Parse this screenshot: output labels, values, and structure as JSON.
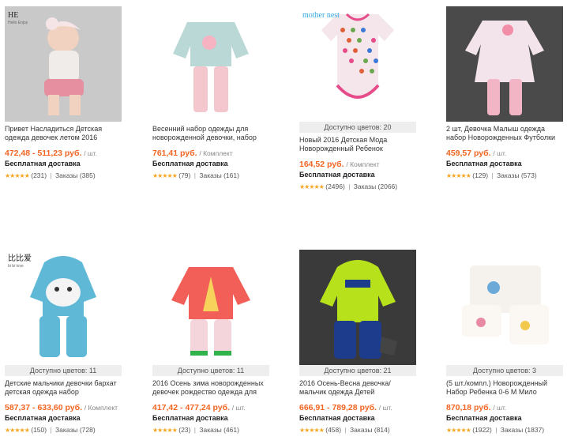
{
  "products": [
    {
      "title": "Привет Насладиться Детская одежда девочек летом 2016",
      "colors": "",
      "price": "472,48 - 511,23 руб.",
      "unit": "/ шт.",
      "shipping": "Бесплатная доставка",
      "reviews": "(231)",
      "orders": "Заказы (385)",
      "brand": "HE",
      "brand_sub": "Hello Enjoy",
      "theme": {
        "bg": "#c9c9c9",
        "main": "#f0ecea",
        "accent": "#e58fa0"
      }
    },
    {
      "title": "Весенний набор одежды для новорожденной девочки, набор",
      "colors": "",
      "price": "761,41 руб.",
      "unit": "/ Комплект",
      "shipping": "Бесплатная доставка",
      "reviews": "(79)",
      "orders": "Заказы (161)",
      "brand": "",
      "brand_sub": "",
      "theme": {
        "bg": "#ffffff",
        "main": "#b9d8d6",
        "accent": "#f4c7cf"
      }
    },
    {
      "title": "Новый 2016 Детская Мода Новорожденный Ребенок",
      "colors": "Доступно цветов: 20",
      "price": "164,52 руб.",
      "unit": "/ Комплект",
      "shipping": "Бесплатная доставка",
      "reviews": "(2496)",
      "orders": "Заказы (2066)",
      "brand": "mother nest",
      "brand_sub": "",
      "theme": {
        "bg": "#ffffff",
        "main": "#f4e6ea",
        "accent": "#e64b8a"
      }
    },
    {
      "title": "2 шт, Девочка Малыш одежда набор Новорожденных Футболки",
      "colors": "",
      "price": "459,57 руб.",
      "unit": "/ шт.",
      "shipping": "Бесплатная доставка",
      "reviews": "(129)",
      "orders": "Заказы (573)",
      "brand": "",
      "brand_sub": "",
      "theme": {
        "bg": "#4a4a4a",
        "main": "#f3e3ea",
        "accent": "#f2b5c6"
      }
    },
    {
      "title": "Детские мальчики девочки бархат детская одежда набор",
      "colors": "Доступно цветов: 11",
      "price": "587,37 - 633,60 руб.",
      "unit": "/ Комплект",
      "shipping": "Бесплатная доставка",
      "reviews": "(150)",
      "orders": "Заказы (728)",
      "brand": "比比爱",
      "brand_sub": "bi bi love",
      "theme": {
        "bg": "#ffffff",
        "main": "#5fb9d6",
        "accent": "#f4f4f4"
      }
    },
    {
      "title": "2016 Осень зима новорожденных девочек рождество одежда для",
      "colors": "Доступно цветов: 11",
      "price": "417,42 - 477,24 руб.",
      "unit": "/ шт.",
      "shipping": "Бесплатная доставка",
      "reviews": "(23)",
      "orders": "Заказы (461)",
      "brand": "",
      "brand_sub": "",
      "theme": {
        "bg": "#ffffff",
        "main": "#f25f58",
        "accent": "#2fb34a"
      }
    },
    {
      "title": "2016 Осень-Весна девочка/мальчик одежда Детей",
      "colors": "Доступно цветов: 21",
      "price": "666,91 - 789,28 руб.",
      "unit": "/ шт.",
      "shipping": "Бесплатная доставка",
      "reviews": "(458)",
      "orders": "Заказы (814)",
      "brand": "",
      "brand_sub": "",
      "theme": {
        "bg": "#3a3a3a",
        "main": "#b7e21b",
        "accent": "#1d3c8c"
      }
    },
    {
      "title": "(5 шт./компл.) Новорожденный Набор Ребенка 0-6 М Мило",
      "colors": "Доступно цветов: 3",
      "price": "870,18 руб.",
      "unit": "/ шт.",
      "shipping": "Бесплатная доставка",
      "reviews": "(1922)",
      "orders": "Заказы (1837)",
      "brand": "",
      "brand_sub": "",
      "theme": {
        "bg": "#ffffff",
        "main": "#f5f1ec",
        "accent": "#6aa9d8"
      }
    }
  ],
  "stars": "★★★★★",
  "separator": "|"
}
